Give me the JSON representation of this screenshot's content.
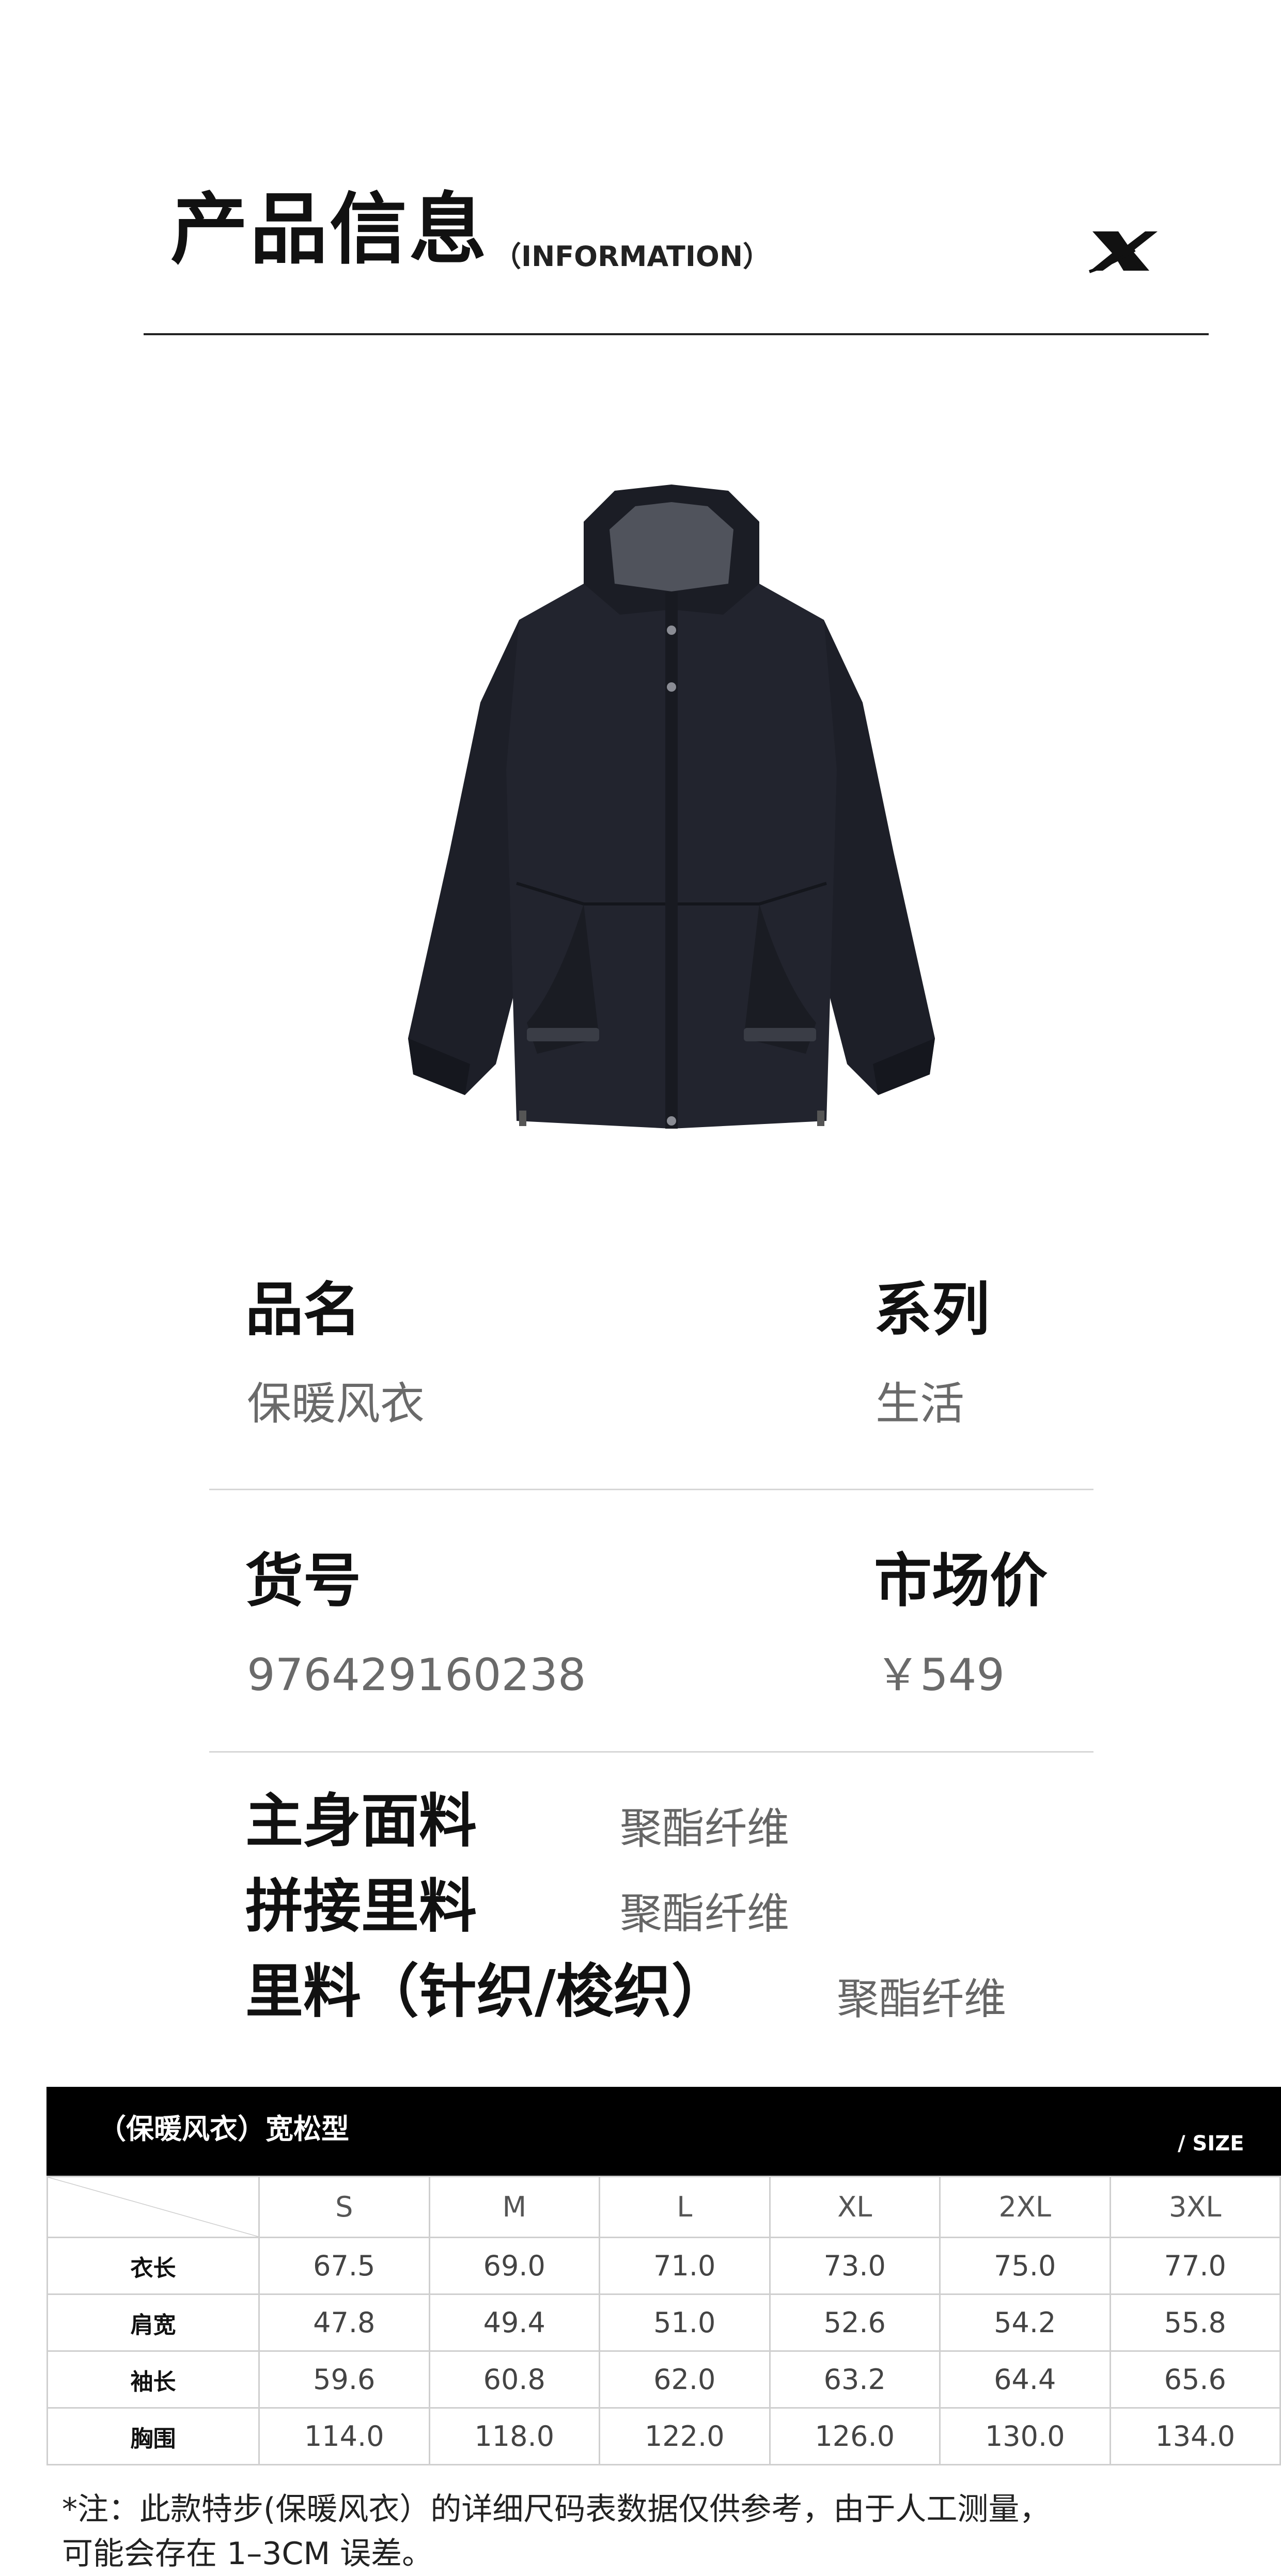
{
  "header": {
    "title": "产品信息",
    "subtitle": "（INFORMATION）",
    "logo_icon": "xtep-x-logo-icon"
  },
  "product": {
    "image_icon": "hooded-jacket-image"
  },
  "info": {
    "name_label": "品名",
    "name_value": "保暖风衣",
    "series_label": "系列",
    "series_value": "生活",
    "sku_label": "货号",
    "sku_value": "976429160238",
    "price_label": "市场价",
    "price_value": "￥549"
  },
  "materials": [
    {
      "label": "主身面料",
      "value": "聚酯纤维"
    },
    {
      "label": "拼接里料",
      "value": "聚酯纤维"
    },
    {
      "label": "里料（针织/梭织）",
      "value": "聚酯纤维"
    }
  ],
  "size_table": {
    "title": "（保暖风衣）宽松型",
    "unit_label": "/ SIZE",
    "sizes": [
      "S",
      "M",
      "L",
      "XL",
      "2XL",
      "3XL"
    ],
    "rows": [
      {
        "label": "衣长",
        "values": [
          "67.5",
          "69.0",
          "71.0",
          "73.0",
          "75.0",
          "77.0"
        ]
      },
      {
        "label": "肩宽",
        "values": [
          "47.8",
          "49.4",
          "51.0",
          "52.6",
          "54.2",
          "55.8"
        ]
      },
      {
        "label": "袖长",
        "values": [
          "59.6",
          "60.8",
          "62.0",
          "63.2",
          "64.4",
          "65.6"
        ]
      },
      {
        "label": "胸围",
        "values": [
          "114.0",
          "118.0",
          "122.0",
          "126.0",
          "130.0",
          "134.0"
        ]
      }
    ]
  },
  "note": {
    "line1": "*注：此款特步(保暖风衣）的详细尺码表数据仅供参考，由于人工测量，",
    "line2": "可能会存在 1–3CM 误差。"
  },
  "colors": {
    "accent": "#000000",
    "label_text": "#111111",
    "value_text": "#6a6a6a",
    "divider": "#d7d7d7"
  }
}
